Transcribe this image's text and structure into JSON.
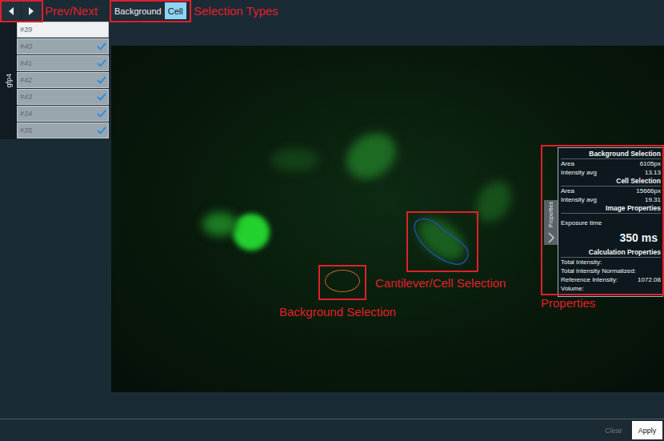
{
  "annotations": {
    "prev_next": "Prev/Next",
    "selection_types": "Selection Types",
    "cell_selection": "Cantilever/Cell Selection",
    "background_selection": "Background Selection",
    "properties": "Properties"
  },
  "selection_types": [
    {
      "label": "Background",
      "selected": false
    },
    {
      "label": "Cell",
      "selected": true
    }
  ],
  "sidebar": {
    "group": "gfp4",
    "items": [
      {
        "label": "#39",
        "selected": true,
        "checked": false
      },
      {
        "label": "#40",
        "selected": false,
        "checked": true
      },
      {
        "label": "#41",
        "selected": false,
        "checked": true
      },
      {
        "label": "#42",
        "selected": false,
        "checked": true
      },
      {
        "label": "#43",
        "selected": false,
        "checked": true
      },
      {
        "label": "#34",
        "selected": false,
        "checked": true
      },
      {
        "label": "#35",
        "selected": false,
        "checked": true
      }
    ]
  },
  "properties": {
    "tab": "Properties",
    "background": {
      "title": "Background Selection",
      "rows": [
        {
          "label": "Area",
          "value": "6105px"
        },
        {
          "label": "Intensity avg",
          "value": "13.13"
        }
      ]
    },
    "cell": {
      "title": "Cell Selection",
      "rows": [
        {
          "label": "Area",
          "value": "15666px"
        },
        {
          "label": "Intensity avg",
          "value": "19.31"
        }
      ]
    },
    "image": {
      "title": "Image Properties",
      "label": "Exposure time",
      "value": "350 ms"
    },
    "calculation": {
      "title": "Calculation Properties",
      "rows": [
        {
          "label": "Total Intensity:",
          "value": ""
        },
        {
          "label": "Total Intensity Normalized:",
          "value": ""
        },
        {
          "label": "Reference Intensity:",
          "value": "1072.08"
        },
        {
          "label": "Volume:",
          "value": ""
        }
      ]
    }
  },
  "buttons": [
    {
      "label": "Clear",
      "disabled": true
    },
    {
      "label": "Apply",
      "disabled": false
    }
  ]
}
